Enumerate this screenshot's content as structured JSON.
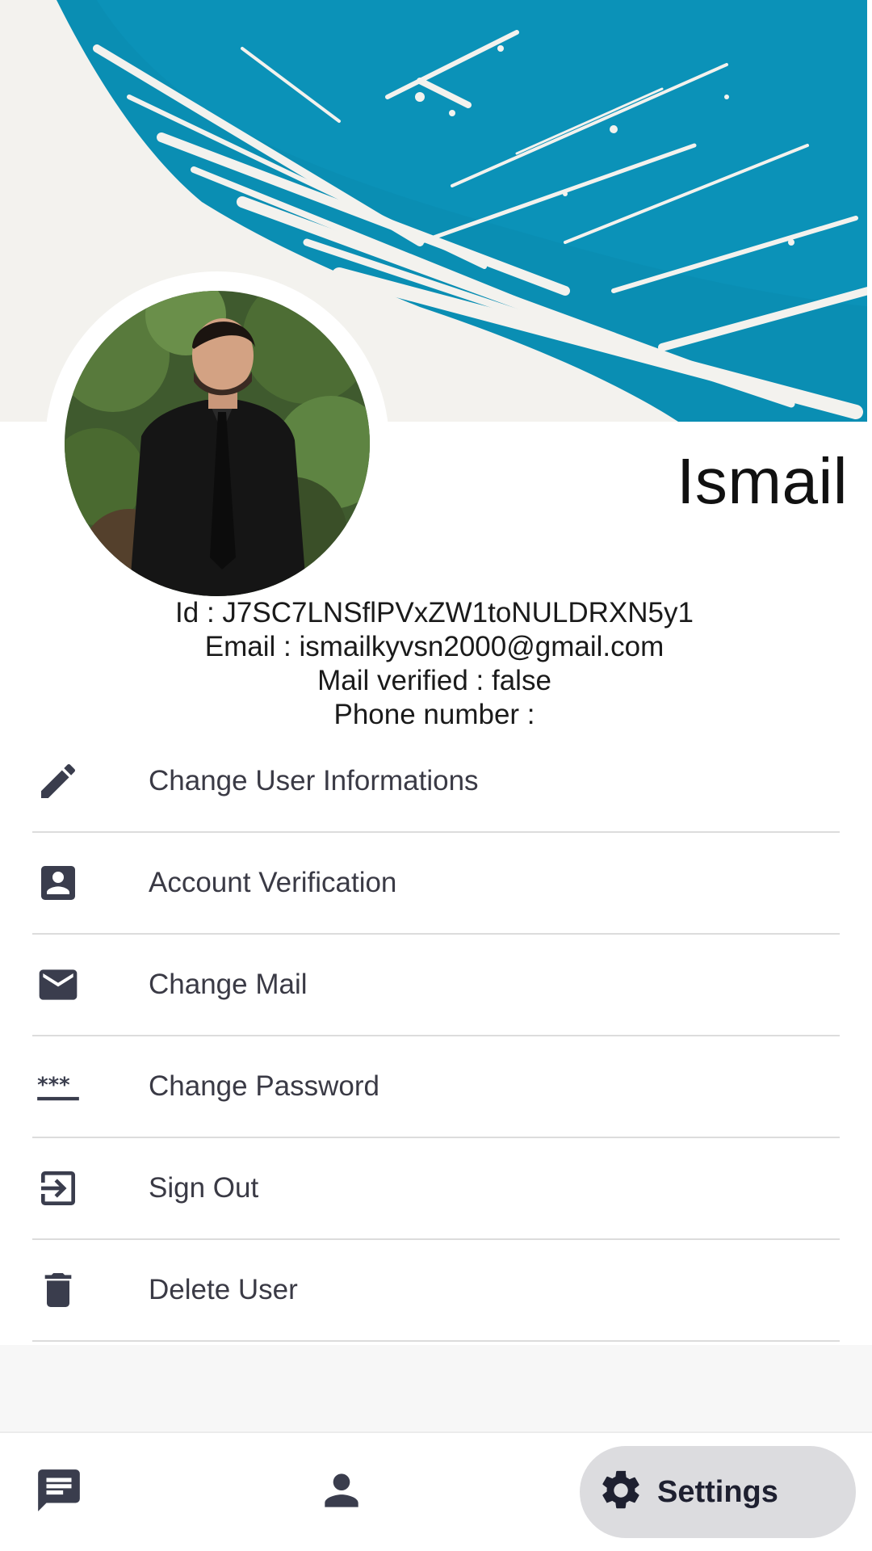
{
  "profile": {
    "name": "Ismail",
    "id_line": "Id : J7SC7LNSflPVxZW1toNULDRXN5y1",
    "email_line": "Email : ismailkyvsn2000@gmail.com",
    "verified_line": "Mail verified : false",
    "phone_line": "Phone number :"
  },
  "menu": {
    "items": [
      {
        "label": "Change User Informations",
        "icon": "pencil-icon"
      },
      {
        "label": "Account Verification",
        "icon": "contact-card-icon"
      },
      {
        "label": "Change Mail",
        "icon": "mail-icon"
      },
      {
        "label": "Change Password",
        "icon": "password-icon"
      },
      {
        "label": "Sign Out",
        "icon": "sign-out-icon"
      },
      {
        "label": "Delete User",
        "icon": "trash-icon"
      }
    ]
  },
  "nav": {
    "chat_icon": "chat-icon",
    "profile_icon": "person-icon",
    "settings_icon": "gear-icon",
    "settings_label": "Settings",
    "active": "settings"
  },
  "colors": {
    "banner_teal": "#0a8eb3",
    "icon_dark": "#3a3d4d",
    "nav_active_bg": "#dcdcdf",
    "divider": "#dcdcdc"
  }
}
